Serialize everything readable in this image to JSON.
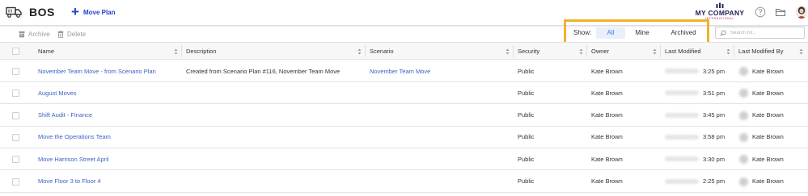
{
  "header": {
    "app_title": "BOS",
    "move_plan_label": "Move Plan",
    "logo_name": "MY COMPANY",
    "logo_sub": "INTERNATIONAL"
  },
  "toolbar": {
    "archive_label": "Archive",
    "delete_label": "Delete",
    "show_label": "Show:",
    "filters": [
      "All",
      "Mine",
      "Archived"
    ],
    "active_filter": "All",
    "search_placeholder": "Search for..."
  },
  "table": {
    "columns": [
      "Name",
      "Description",
      "Scenario",
      "Security",
      "Owner",
      "Last Modified",
      "Last Modified By"
    ],
    "rows": [
      {
        "name": "November Team Move - from Scenario Plan",
        "description": "Created from Scenario Plan #116, November Team Move",
        "scenario": "November Team Move",
        "security": "Public",
        "owner": "Kate Brown",
        "time": "3:25 pm",
        "modified_by": "Kate Brown"
      },
      {
        "name": "August Moves",
        "description": "",
        "scenario": "",
        "security": "Public",
        "owner": "Kate Brown",
        "time": "3:51 pm",
        "modified_by": "Kate Brown"
      },
      {
        "name": "Shift Audit - Finance",
        "description": "",
        "scenario": "",
        "security": "Public",
        "owner": "Kate Brown",
        "time": "3:45 pm",
        "modified_by": "Kate Brown"
      },
      {
        "name": "Move the Operations Team",
        "description": "",
        "scenario": "",
        "security": "Public",
        "owner": "Kate Brown",
        "time": "3:58 pm",
        "modified_by": "Kate Brown"
      },
      {
        "name": "Move Harrison Street April",
        "description": "",
        "scenario": "",
        "security": "Public",
        "owner": "Kate Brown",
        "time": "3:30 pm",
        "modified_by": "Kate Brown"
      },
      {
        "name": "Move Floor 3 to Floor 4",
        "description": "",
        "scenario": "",
        "security": "Public",
        "owner": "Kate Brown",
        "time": "2:25 pm",
        "modified_by": "Kate Brown"
      }
    ]
  },
  "colors": {
    "accent_blue": "#1f3fd1",
    "link_blue": "#3b62c7",
    "highlight_box": "#f0b22b",
    "logo_navy": "#23245a"
  },
  "icons": [
    "truck-icon",
    "plus-icon",
    "help-icon",
    "folder-icon",
    "avatar",
    "archive-icon",
    "trash-icon",
    "search-icon",
    "sort-icon"
  ]
}
